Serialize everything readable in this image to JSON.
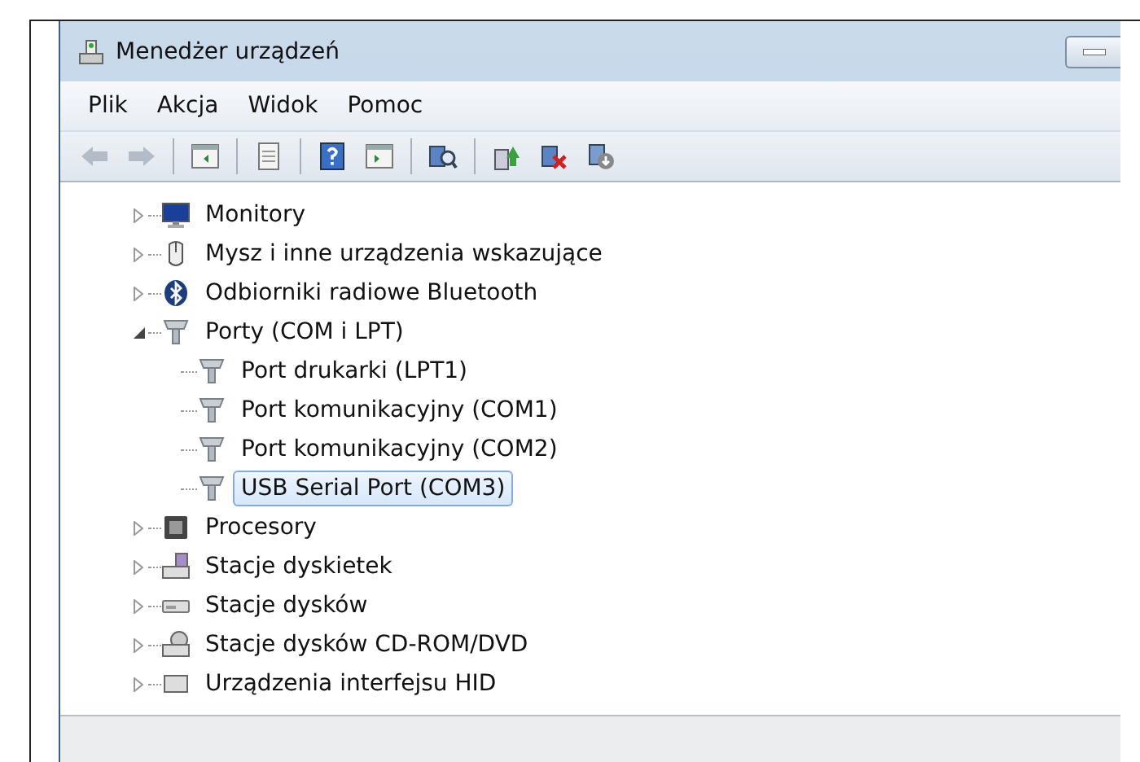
{
  "window": {
    "title": "Menedżer urządzeń"
  },
  "menu": [
    "Plik",
    "Akcja",
    "Widok",
    "Pomoc"
  ],
  "toolbar": [
    {
      "kind": "back",
      "disabled": true
    },
    {
      "kind": "forward",
      "disabled": true
    },
    {
      "kind": "separator"
    },
    {
      "kind": "tree-pane"
    },
    {
      "kind": "separator"
    },
    {
      "kind": "properties"
    },
    {
      "kind": "separator"
    },
    {
      "kind": "help"
    },
    {
      "kind": "action-pane"
    },
    {
      "kind": "separator"
    },
    {
      "kind": "scan"
    },
    {
      "kind": "separator"
    },
    {
      "kind": "update"
    },
    {
      "kind": "uninstall"
    },
    {
      "kind": "disable"
    }
  ],
  "tree": [
    {
      "label": "Monitory",
      "kind": "monitor",
      "expanded": false,
      "selected": false
    },
    {
      "label": "Mysz i inne urządzenia wskazujące",
      "kind": "mouse",
      "expanded": false,
      "selected": false
    },
    {
      "label": "Odbiorniki radiowe Bluetooth",
      "kind": "bluetooth",
      "expanded": false,
      "selected": false
    },
    {
      "label": "Porty (COM i LPT)",
      "kind": "port",
      "expanded": true,
      "selected": false,
      "children": [
        {
          "label": "Port drukarki (LPT1)",
          "kind": "port",
          "selected": false
        },
        {
          "label": "Port komunikacyjny (COM1)",
          "kind": "port",
          "selected": false
        },
        {
          "label": "Port komunikacyjny (COM2)",
          "kind": "port",
          "selected": false
        },
        {
          "label": "USB Serial Port (COM3)",
          "kind": "port",
          "selected": true
        }
      ]
    },
    {
      "label": "Procesory",
      "kind": "cpu",
      "expanded": false,
      "selected": false
    },
    {
      "label": "Stacje dyskietek",
      "kind": "floppy",
      "expanded": false,
      "selected": false
    },
    {
      "label": "Stacje dysków",
      "kind": "disk",
      "expanded": false,
      "selected": false
    },
    {
      "label": "Stacje dysków CD-ROM/DVD",
      "kind": "cdrom",
      "expanded": false,
      "selected": false
    },
    {
      "label": "Urządzenia interfejsu HID",
      "kind": "hid",
      "expanded": false,
      "selected": false
    }
  ]
}
